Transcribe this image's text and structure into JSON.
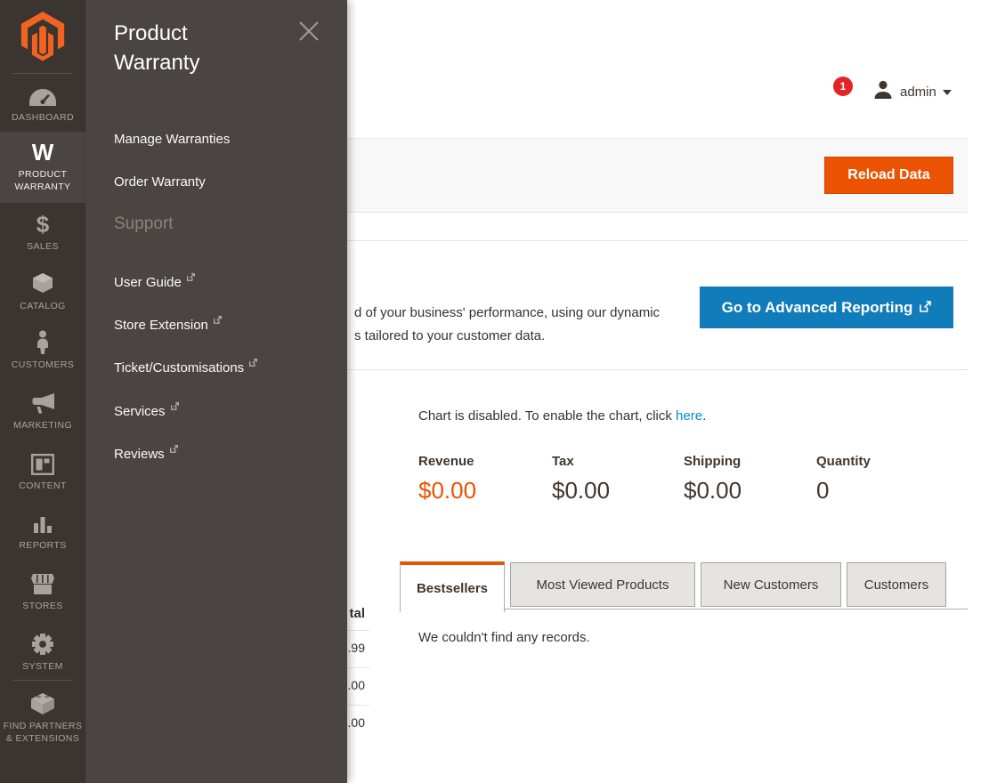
{
  "colors": {
    "accent_orange": "#eb5202",
    "button_blue": "#107cba",
    "link_blue": "#008bdb",
    "sidebar_bg": "#3a3530",
    "flyout_bg": "#4a4542",
    "badge_red": "#e22626"
  },
  "icons": [
    "magento-logo",
    "dashboard-icon",
    "product-warranty-icon",
    "sales-icon",
    "catalog-icon",
    "customers-icon",
    "marketing-icon",
    "content-icon",
    "reports-icon",
    "stores-icon",
    "system-icon",
    "find-partners-icon",
    "search-icon",
    "bell-icon",
    "user-avatar-icon",
    "caret-down-icon",
    "close-icon",
    "external-link-icon"
  ],
  "sidebar": {
    "items": [
      {
        "label": "DASHBOARD",
        "selected": false
      },
      {
        "label": "PRODUCT WARRANTY",
        "selected": true,
        "glyph": "W"
      },
      {
        "label": "SALES",
        "selected": false,
        "glyph": "$"
      },
      {
        "label": "CATALOG",
        "selected": false
      },
      {
        "label": "CUSTOMERS",
        "selected": false
      },
      {
        "label": "MARKETING",
        "selected": false
      },
      {
        "label": "CONTENT",
        "selected": false
      },
      {
        "label": "REPORTS",
        "selected": false
      },
      {
        "label": "STORES",
        "selected": false
      },
      {
        "label": "SYSTEM",
        "selected": false
      },
      {
        "label": "FIND PARTNERS & EXTENSIONS",
        "selected": false
      }
    ]
  },
  "flyout": {
    "title": "Product Warranty",
    "items": [
      {
        "label": "Manage Warranties"
      },
      {
        "label": "Order Warranty"
      }
    ],
    "section_heading": "Support",
    "support_items": [
      {
        "label": "User Guide"
      },
      {
        "label": "Store Extension"
      },
      {
        "label": "Ticket/Customisations"
      },
      {
        "label": "Services"
      },
      {
        "label": "Reviews"
      }
    ]
  },
  "header": {
    "username": "admin",
    "notification_count": "1"
  },
  "page_actions": {
    "reload_button": "Reload Data"
  },
  "advanced_reporting": {
    "visible_text_line1": "d of your business' performance, using our dynamic",
    "visible_text_line2": "s tailored to your customer data.",
    "button_label": "Go to Advanced Reporting"
  },
  "chart_notice": {
    "text_before_link": "Chart is disabled. To enable the chart, click ",
    "link_text": "here",
    "text_after_link": "."
  },
  "stats": [
    {
      "label": "Revenue",
      "value": "$0.00",
      "highlighted": true
    },
    {
      "label": "Tax",
      "value": "$0.00",
      "highlighted": false
    },
    {
      "label": "Shipping",
      "value": "$0.00",
      "highlighted": false
    },
    {
      "label": "Quantity",
      "value": "0",
      "highlighted": false
    }
  ],
  "tabs": {
    "items": [
      {
        "label": "Bestsellers",
        "active": true
      },
      {
        "label": "Most Viewed Products",
        "active": false
      },
      {
        "label": "New Customers",
        "active": false
      },
      {
        "label": "Customers",
        "active": false
      }
    ],
    "empty_message": "We couldn't find any records."
  },
  "clipped_table": {
    "header_fragment": "tal",
    "row_fragments": [
      ".99",
      ".00",
      ".00"
    ]
  }
}
